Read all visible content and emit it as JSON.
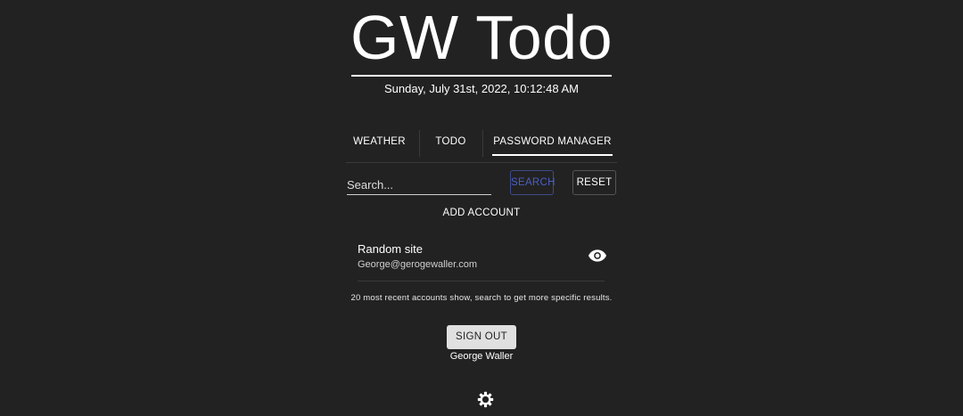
{
  "header": {
    "title": "GW Todo",
    "datetime": "Sunday, July 31st, 2022, 10:12:48 AM"
  },
  "tabs": [
    {
      "label": "WEATHER",
      "active": false
    },
    {
      "label": "TODO",
      "active": false
    },
    {
      "label": "PASSWORD MANAGER",
      "active": true
    }
  ],
  "search": {
    "placeholder": "Search...",
    "value": "",
    "search_label": "SEARCH",
    "reset_label": "RESET"
  },
  "add_account_label": "ADD ACCOUNT",
  "accounts": [
    {
      "name": "Random site",
      "email": "George@gerogewaller.com",
      "icon": "eye-icon"
    }
  ],
  "note": "20 most recent accounts show, search to get more specific results.",
  "user": {
    "signout_label": "SIGN OUT",
    "name": "George Waller"
  },
  "settings_icon": "settings-icon",
  "colors": {
    "background": "#222222",
    "text": "#ffffff",
    "accent": "#4a5fc7",
    "signout_bg": "#e0e0e0"
  }
}
